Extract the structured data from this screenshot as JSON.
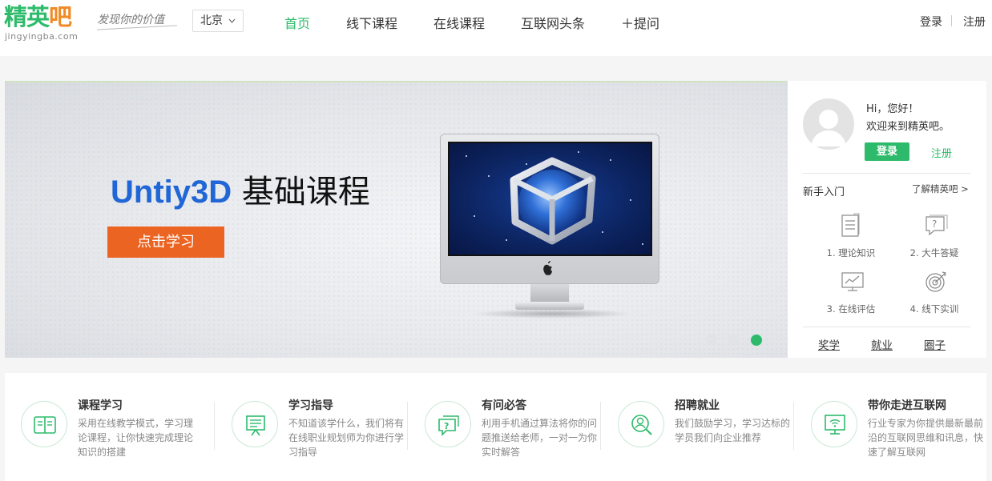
{
  "header": {
    "logo_main": "精英",
    "logo_ba": "吧",
    "logo_sub": "jingyingba.com",
    "slogan": "发现你的价值",
    "city": "北京",
    "nav": [
      "首页",
      "线下课程",
      "在线课程",
      "互联网头条",
      "＋提问"
    ],
    "login": "登录",
    "register": "注册"
  },
  "banner": {
    "title_en": "Untiy3D",
    "title_cn": "基础课程",
    "button": "点击学习",
    "slides": 3,
    "active_slide": 3
  },
  "user_panel": {
    "greeting": "Hi，您好！",
    "welcome": "欢迎来到精英吧。",
    "login": "登录",
    "register": "注册",
    "guide_title": "新手入门",
    "guide_more": "了解精英吧 >",
    "guide_items": [
      "1. 理论知识",
      "2. 大牛答疑",
      "3. 在线评估",
      "4. 线下实训"
    ],
    "links": [
      "奖学",
      "就业",
      "圈子"
    ]
  },
  "features": [
    {
      "title": "课程学习",
      "desc": "采用在线教学模式，学习理论课程，让你快速完成理论知识的搭建"
    },
    {
      "title": "学习指导",
      "desc": "不知道该学什么，我们将有在线职业规划师为你进行学习指导"
    },
    {
      "title": "有问必答",
      "desc": "利用手机通过算法将你的问题推送给老师，一对一为你实时解答"
    },
    {
      "title": "招聘就业",
      "desc": "我们鼓励学习，学习达标的学员我们向企业推荐"
    },
    {
      "title": "带你走进互联网",
      "desc": "行业专家为你提供最新最前沿的互联网思维和讯息，快速了解互联网"
    }
  ],
  "colors": {
    "accent": "#2dbb6b",
    "brand_orange": "#f08a24",
    "cta": "#ec6421",
    "title_blue": "#2066d6"
  }
}
